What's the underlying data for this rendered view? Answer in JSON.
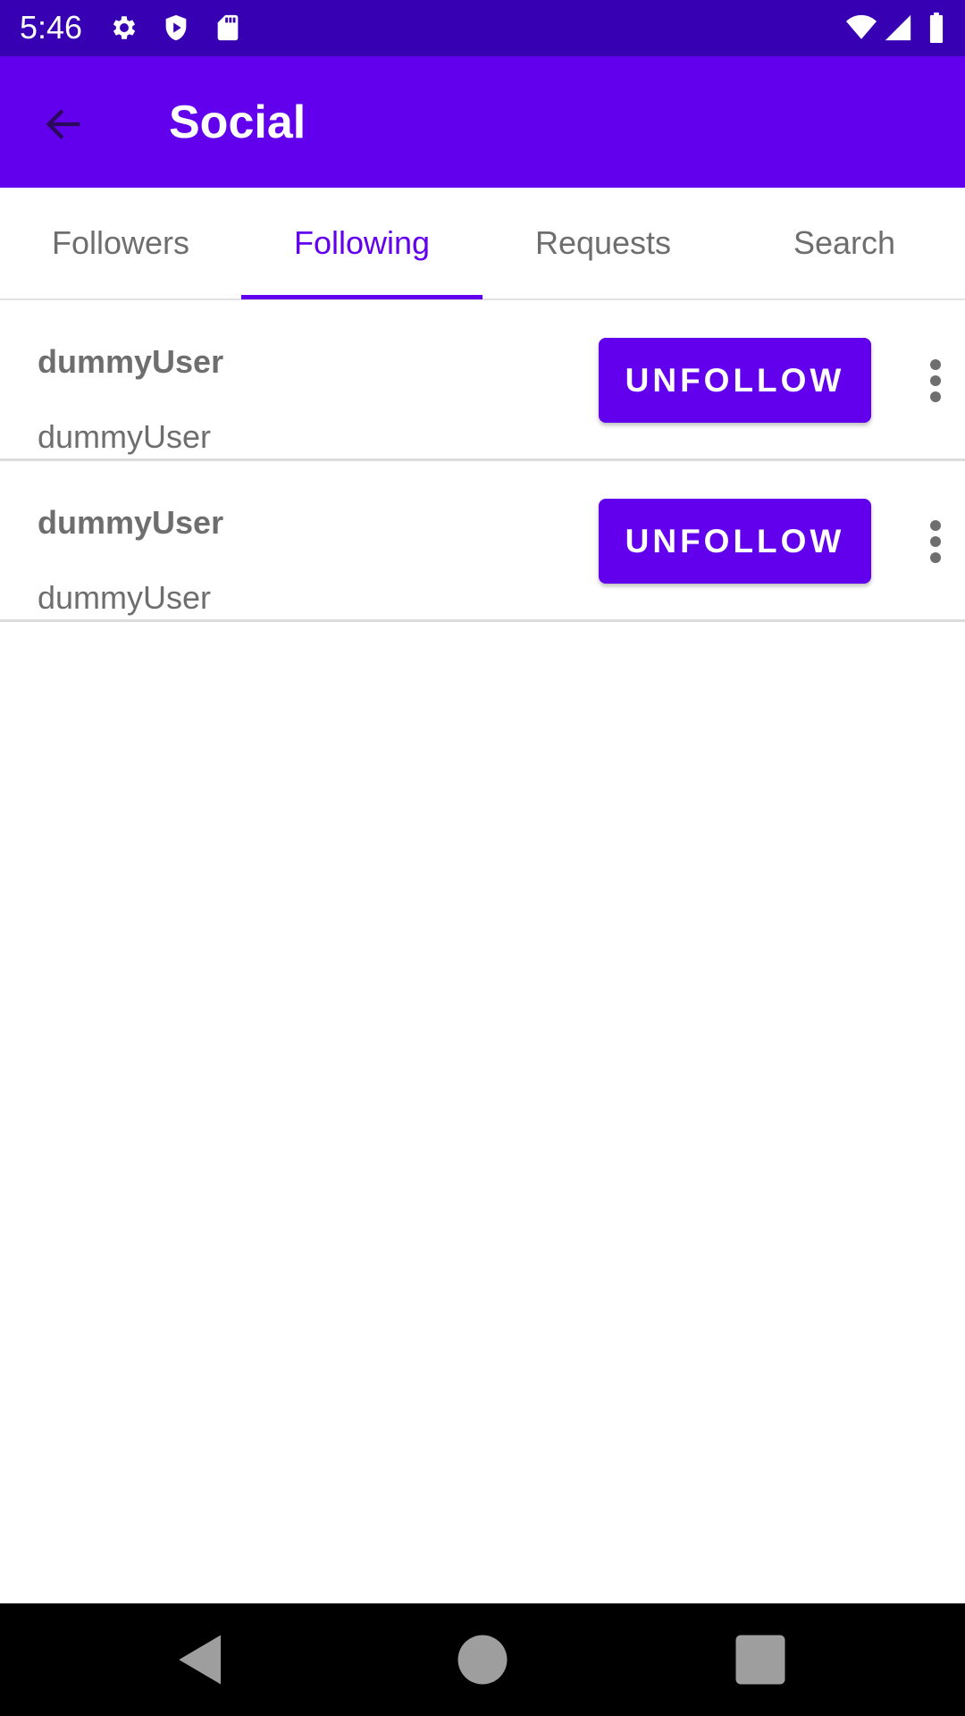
{
  "status_bar": {
    "time": "5:46",
    "left_icons": [
      "settings-icon",
      "shield-play-icon",
      "sd-card-icon"
    ],
    "right_icons": [
      "wifi-icon",
      "signal-icon",
      "battery-icon"
    ]
  },
  "app_bar": {
    "title": "Social",
    "back_icon": "arrow-back-icon",
    "color": "#6200ee"
  },
  "tabs": [
    {
      "label": "Followers",
      "active": false
    },
    {
      "label": "Following",
      "active": true
    },
    {
      "label": "Requests",
      "active": false
    },
    {
      "label": "Search",
      "active": false
    }
  ],
  "following": [
    {
      "name": "dummyUser",
      "handle": "dummyUser",
      "action_label": "UNFOLLOW"
    },
    {
      "name": "dummyUser",
      "handle": "dummyUser",
      "action_label": "UNFOLLOW"
    }
  ],
  "nav_bar": {
    "icons": [
      "back-triangle-icon",
      "home-circle-icon",
      "recents-square-icon"
    ]
  },
  "colors": {
    "status_bar": "#3700b3",
    "primary": "#6200ee",
    "text_muted": "#6e6e6e"
  }
}
